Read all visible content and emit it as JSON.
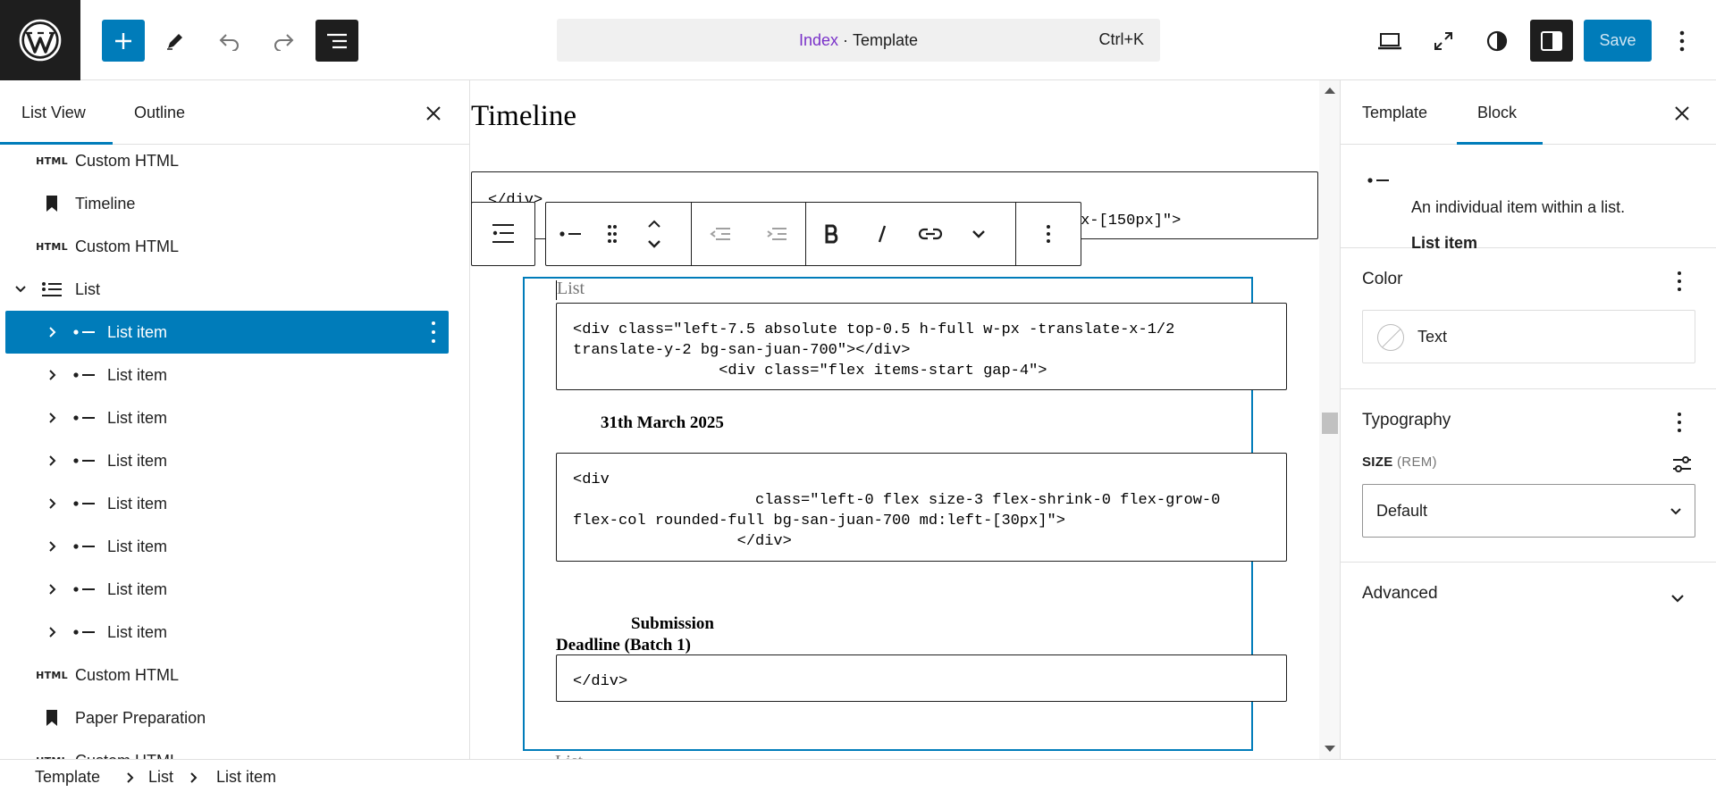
{
  "topbar": {
    "template_name": "Index",
    "template_type": "Template",
    "separator": " · ",
    "shortcut": "Ctrl+K",
    "save_label": "Save",
    "icons": [
      "wordpress-logo",
      "plus-icon",
      "pen-icon",
      "undo-icon",
      "redo-icon",
      "document-overview-icon",
      "desktop-icon",
      "fullscreen-icon",
      "styles-icon",
      "sidebar-icon",
      "more-vertical-icon"
    ]
  },
  "left_sidebar": {
    "tabs": [
      {
        "label": "List View",
        "active": true
      },
      {
        "label": "Outline",
        "active": false
      }
    ],
    "items": [
      {
        "type": "html",
        "icon_text": "HTML",
        "label": "Custom HTML"
      },
      {
        "type": "bookmark",
        "label": "Timeline"
      },
      {
        "type": "html",
        "icon_text": "HTML",
        "label": "Custom HTML"
      },
      {
        "type": "list",
        "label": "List",
        "expanded": true
      },
      {
        "type": "list-item",
        "label": "List item",
        "selected": true
      },
      {
        "type": "list-item",
        "label": "List item"
      },
      {
        "type": "list-item",
        "label": "List item"
      },
      {
        "type": "list-item",
        "label": "List item"
      },
      {
        "type": "list-item",
        "label": "List item"
      },
      {
        "type": "list-item",
        "label": "List item"
      },
      {
        "type": "list-item",
        "label": "List item"
      },
      {
        "type": "list-item",
        "label": "List item"
      },
      {
        "type": "html",
        "icon_text": "HTML",
        "label": "Custom HTML"
      },
      {
        "type": "bookmark",
        "label": "Paper Preparation"
      },
      {
        "type": "html",
        "icon_text": "HTML",
        "label": "Custom HTML"
      }
    ]
  },
  "canvas": {
    "heading": "Timeline",
    "top_code": "</div>\n                                                                 x-[150px]\">",
    "list_placeholder": "List",
    "code1": "<div class=\"left-7.5 absolute top-0.5 h-full w-px -translate-x-1/2\ntranslate-y-2 bg-san-juan-700\"></div>\n                <div class=\"flex items-start gap-4\">",
    "date": "31th March 2025",
    "code2": "<div\n                    class=\"left-0 flex size-3 flex-shrink-0 flex-grow-0\nflex-col rounded-full bg-san-juan-700 md:left-[30px]\">\n                  </div>",
    "submission_line1": "Submission",
    "submission_line2": "Deadline (Batch 1)",
    "code3": "</div>",
    "list_placeholder_bottom": "List"
  },
  "right_sidebar": {
    "tabs": [
      {
        "label": "Template",
        "active": false
      },
      {
        "label": "Block",
        "active": true
      }
    ],
    "block": {
      "name": "List item",
      "description": "An individual item within a list."
    },
    "color": {
      "title": "Color",
      "item_label": "Text"
    },
    "typography": {
      "title": "Typography",
      "size_label": "SIZE",
      "size_unit": "(REM)",
      "size_value": "Default"
    },
    "advanced": {
      "title": "Advanced"
    }
  },
  "breadcrumb": [
    "Template",
    "List",
    "List item"
  ],
  "colors": {
    "accent": "#007cba",
    "dark": "#1e1e1e",
    "template_name": "#7a32c9"
  }
}
